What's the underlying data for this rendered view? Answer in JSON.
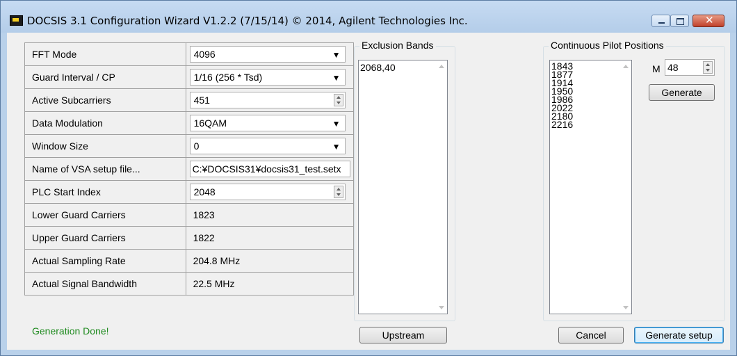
{
  "window": {
    "title": "DOCSIS 3.1 Configuration Wizard V1.2.2 (7/15/14)  © 2014, Agilent Technologies Inc."
  },
  "params": [
    {
      "label": "FFT Mode",
      "value": "4096",
      "control": "dropdown"
    },
    {
      "label": "Guard Interval / CP",
      "value": "1/16 (256 * Tsd)",
      "control": "dropdown"
    },
    {
      "label": "Active Subcarriers",
      "value": "451",
      "control": "spinner"
    },
    {
      "label": "Data Modulation",
      "value": "16QAM",
      "control": "dropdown"
    },
    {
      "label": "Window Size",
      "value": "0",
      "control": "dropdown"
    },
    {
      "label": "Name of VSA setup file...",
      "value": "C:¥DOCSIS31¥docsis31_test.setx",
      "control": "textbox"
    },
    {
      "label": "PLC Start Index",
      "value": "2048",
      "control": "spinner"
    },
    {
      "label": "Lower Guard Carriers",
      "value": "1823",
      "control": "static"
    },
    {
      "label": "Upper Guard Carriers",
      "value": "1822",
      "control": "static"
    },
    {
      "label": "Actual Sampling Rate",
      "value": "204.8 MHz",
      "control": "static"
    },
    {
      "label": "Actual Signal Bandwidth",
      "value": "22.5 MHz",
      "control": "static"
    }
  ],
  "status": {
    "text": "Generation Done!",
    "color": "#1e8a1e"
  },
  "exclusion": {
    "label": "Exclusion Bands",
    "items": [
      "2068,40"
    ]
  },
  "pilots": {
    "label": "Continuous Pilot Positions",
    "items": [
      "1843",
      "1877",
      "1914",
      "1950",
      "1986",
      "2022",
      "2180",
      "2216"
    ],
    "m_label": "M",
    "m_value": "48",
    "generate_label": "Generate"
  },
  "buttons": {
    "upstream": "Upstream",
    "cancel": "Cancel",
    "generate_setup": "Generate setup"
  }
}
